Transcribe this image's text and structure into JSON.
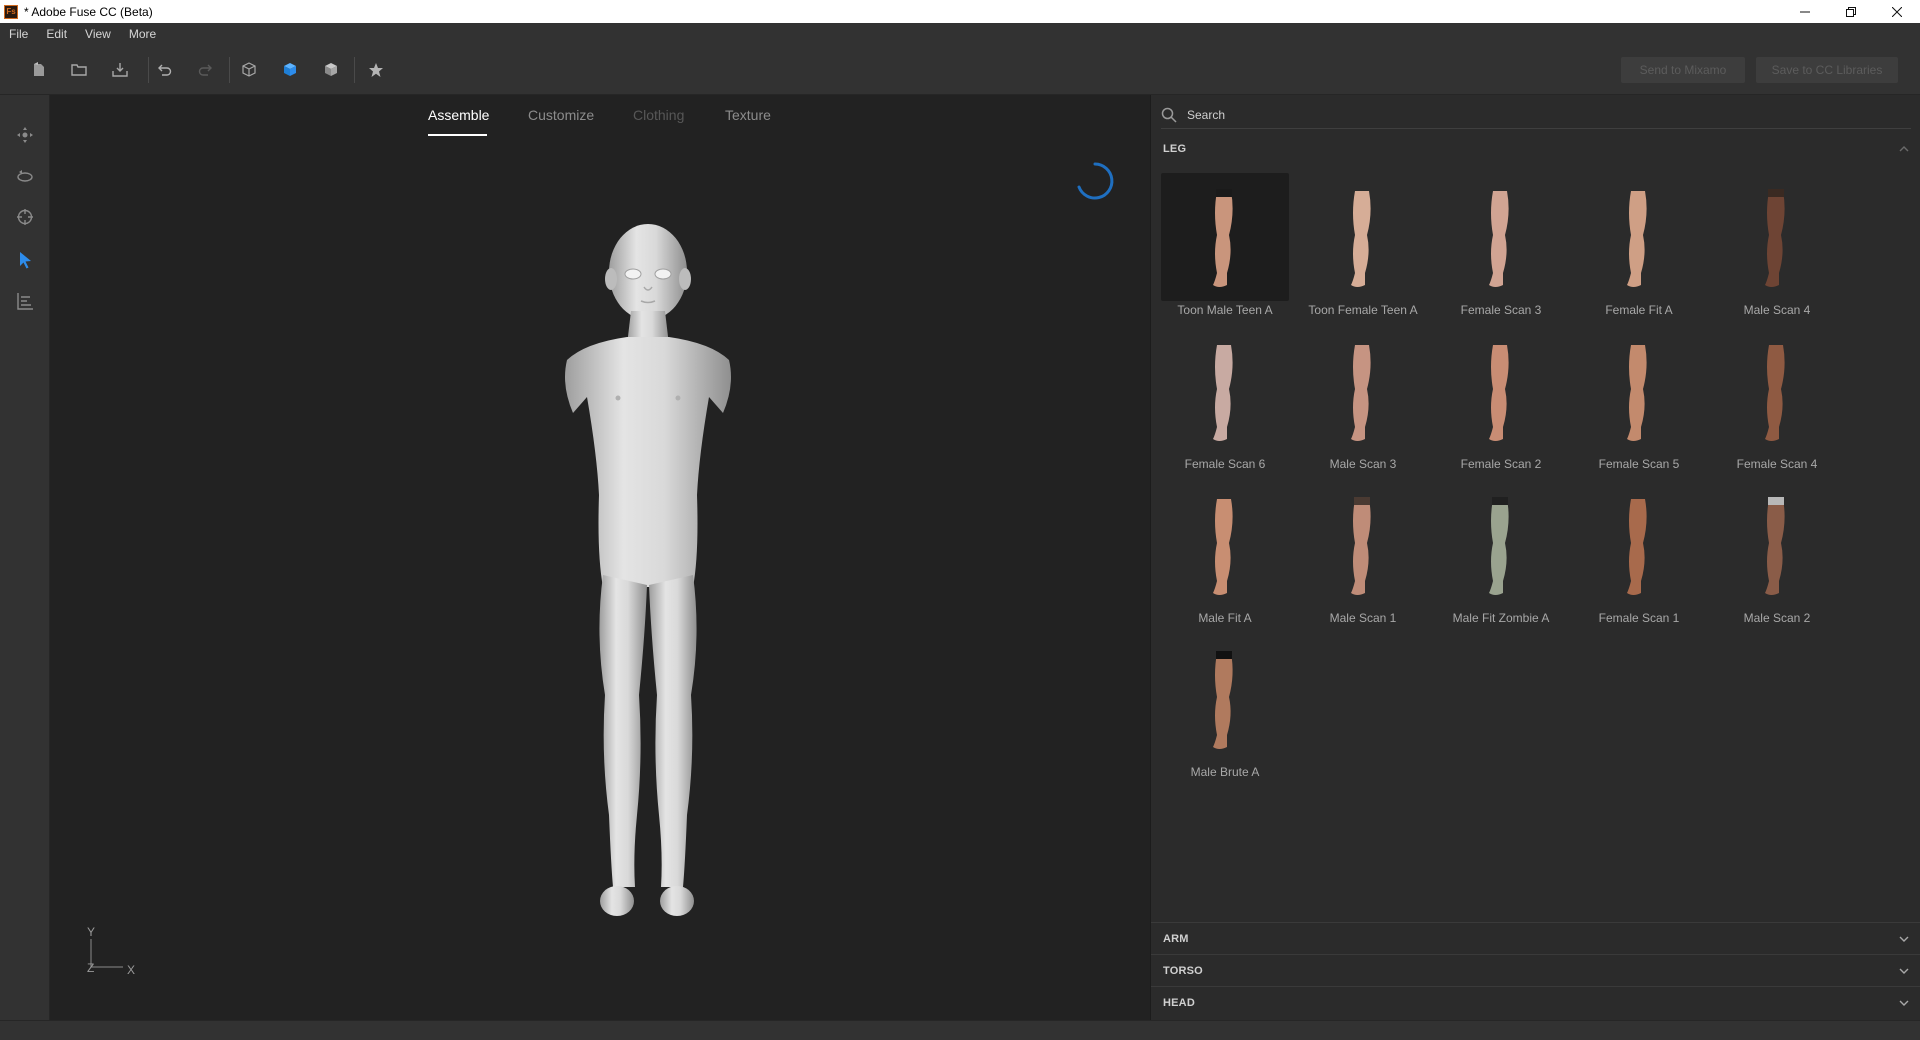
{
  "window": {
    "title": "* Adobe Fuse CC (Beta)",
    "app_icon_text": "Fs"
  },
  "menu": [
    "File",
    "Edit",
    "View",
    "More"
  ],
  "toolbar": {
    "icons": [
      "new-file-icon",
      "open-folder-icon",
      "import-icon",
      "undo-icon",
      "redo-icon",
      "cube-outline-icon",
      "cube-solid-icon",
      "cube-textured-icon",
      "star-icon"
    ],
    "send_to_mixamo": "Send to Mixamo",
    "save_to_libraries": "Save to CC Libraries"
  },
  "left_tools": [
    "move-tool-icon",
    "orbit-tool-icon",
    "target-tool-icon",
    "select-tool-icon",
    "pose-tool-icon"
  ],
  "tabs": [
    {
      "label": "Assemble",
      "state": "active"
    },
    {
      "label": "Customize",
      "state": "normal"
    },
    {
      "label": "Clothing",
      "state": "disabled"
    },
    {
      "label": "Texture",
      "state": "normal"
    }
  ],
  "axis": {
    "y": "Y",
    "z": "Z",
    "x": "X"
  },
  "search": {
    "placeholder": "Search"
  },
  "leg_section": {
    "title": "LEG"
  },
  "leg_items": [
    {
      "label": "Toon Male Teen A",
      "skin": "#c9957c",
      "top": "#1a1a1a",
      "selected": true
    },
    {
      "label": "Toon Female Teen A",
      "skin": "#d6ad97",
      "top": null,
      "selected": false
    },
    {
      "label": "Female Scan 3",
      "skin": "#d1a493",
      "top": null,
      "selected": false
    },
    {
      "label": "Female Fit A",
      "skin": "#cf9f85",
      "top": null,
      "selected": false
    },
    {
      "label": "Male Scan 4",
      "skin": "#6e4434",
      "top": "#3a2a22",
      "selected": false
    },
    {
      "label": "Female Scan 6",
      "skin": "#c8aaa2",
      "top": null,
      "selected": false
    },
    {
      "label": "Male Scan 3",
      "skin": "#c69482",
      "top": null,
      "selected": false
    },
    {
      "label": "Female Scan 2",
      "skin": "#c98d74",
      "top": null,
      "selected": false
    },
    {
      "label": "Female Scan 5",
      "skin": "#c38a6d",
      "top": null,
      "selected": false
    },
    {
      "label": "Female Scan 4",
      "skin": "#8f5a42",
      "top": null,
      "selected": false
    },
    {
      "label": "Male Fit A",
      "skin": "#c88e72",
      "top": null,
      "selected": false
    },
    {
      "label": "Male Scan 1",
      "skin": "#bf8c78",
      "top": "#4a3a32",
      "selected": false
    },
    {
      "label": "Male Fit Zombie A",
      "skin": "#9aa38f",
      "top": "#202020",
      "selected": false
    },
    {
      "label": "Female Scan 1",
      "skin": "#a86a4c",
      "top": null,
      "selected": false
    },
    {
      "label": "Male Scan 2",
      "skin": "#8a5c48",
      "top": "#b8b8b8",
      "selected": false
    },
    {
      "label": "Male Brute A",
      "skin": "#b07a5e",
      "top": "#111111",
      "selected": false
    }
  ],
  "collapsed_sections": [
    "ARM",
    "TORSO",
    "HEAD"
  ],
  "colors": {
    "accent": "#2d8ceb",
    "panel": "#2b2b2b",
    "viewport": "#222222"
  }
}
